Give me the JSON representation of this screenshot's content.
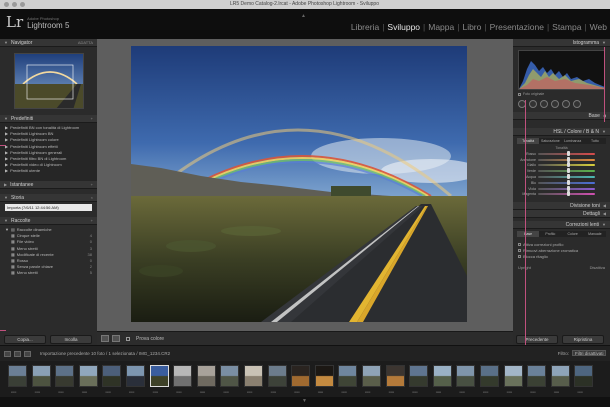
{
  "window": {
    "title": "LR5 Demo Catalog-2.lrcat - Adobe Photoshop Lightroom - Sviluppo"
  },
  "identity": {
    "mark": "Lr",
    "small": "Adobe Photoshop",
    "product": "Lightroom 5"
  },
  "modules": [
    "Libreria",
    "Sviluppo",
    "Mappa",
    "Libro",
    "Presentazione",
    "Stampa",
    "Web"
  ],
  "active_module": "Sviluppo",
  "left_panel": {
    "navigator": {
      "title": "Navigator",
      "zoom": "ADATTA"
    },
    "presets": {
      "title": "Predefiniti",
      "items": [
        "Predefiniti BN con tonalità di Lightroom",
        "Predefiniti Lightroom BN",
        "Predefiniti Lightroom colore",
        "Predefiniti Lightroom effetti",
        "Predefiniti Lightroom generali",
        "Predefiniti filtro BN di Lightroom",
        "Predefiniti video di Lightroom",
        "Predefiniti utente"
      ]
    },
    "snapshots": {
      "title": "Istantanee"
    },
    "history": {
      "title": "Storia",
      "entry": "Importa (7/6/11 12:44:56 AM)"
    },
    "collections": {
      "title": "Raccolte",
      "group": "Raccolte dinamiche",
      "items": [
        {
          "name": "Cinque stelle",
          "count": "4"
        },
        {
          "name": "File video",
          "count": "0"
        },
        {
          "name": "Meno stretti",
          "count": "3"
        },
        {
          "name": "Modificate di recente",
          "count": "38"
        },
        {
          "name": "Rosso",
          "count": "0"
        },
        {
          "name": "Senza parole chiave",
          "count": "2"
        },
        {
          "name": "Meno stretti",
          "count": "5"
        }
      ]
    },
    "buttons": {
      "copy": "Copia...",
      "paste": "Incolla"
    }
  },
  "toolbar": {
    "label": "Prova colore"
  },
  "filmstrip": {
    "path": "Importazione precedente   10 foto / 1 selezionata / IMG_1234.CR2",
    "filter_label": "Filtro:",
    "filter_value": "Filtri disattivati",
    "thumb_count": 25,
    "selected_index": 6
  },
  "right_panel": {
    "histogram": {
      "title": "Istogramma",
      "original_label": "Foto originale"
    },
    "basic": {
      "title": "Base"
    },
    "hsl": {
      "title": "HSL / Colore / B & N",
      "tabs": [
        "Tonalità",
        "Saturazione",
        "Luminanza",
        "Tutto"
      ],
      "section": "Tonalità",
      "sliders": [
        {
          "name": "Rosso",
          "color": "#d64b4b",
          "value": 0.5
        },
        {
          "name": "Arancione",
          "color": "#e08a3c",
          "value": 0.5
        },
        {
          "name": "Giallo",
          "color": "#d8cf3c",
          "value": 0.5
        },
        {
          "name": "Verde",
          "color": "#5bb24c",
          "value": 0.5
        },
        {
          "name": "Acqua",
          "color": "#4cb8b4",
          "value": 0.5
        },
        {
          "name": "Blu",
          "color": "#4b6fd6",
          "value": 0.5
        },
        {
          "name": "Viola",
          "color": "#8d5bd0",
          "value": 0.5
        },
        {
          "name": "Magenta",
          "color": "#cf4fb0",
          "value": 0.5
        }
      ]
    },
    "split_toning": {
      "title": "Divisione toni"
    },
    "detail": {
      "title": "Dettagli"
    },
    "lens": {
      "title": "Correzioni lenti",
      "tabs": [
        "Base",
        "Profilo",
        "Colore",
        "Manuale"
      ],
      "options": [
        "Attiva correzioni profilo",
        "Rimuovi aberrazione cromatica",
        "Blocca ritaglio"
      ],
      "upright_label": "Upright",
      "upright_value": "Disattiva"
    },
    "buttons": {
      "previous": "Precedente",
      "reset": "Ripristina"
    }
  },
  "colors": {
    "accent": "#c0517e",
    "panel": "#2b2b2b",
    "background": "#5e5e5e"
  }
}
